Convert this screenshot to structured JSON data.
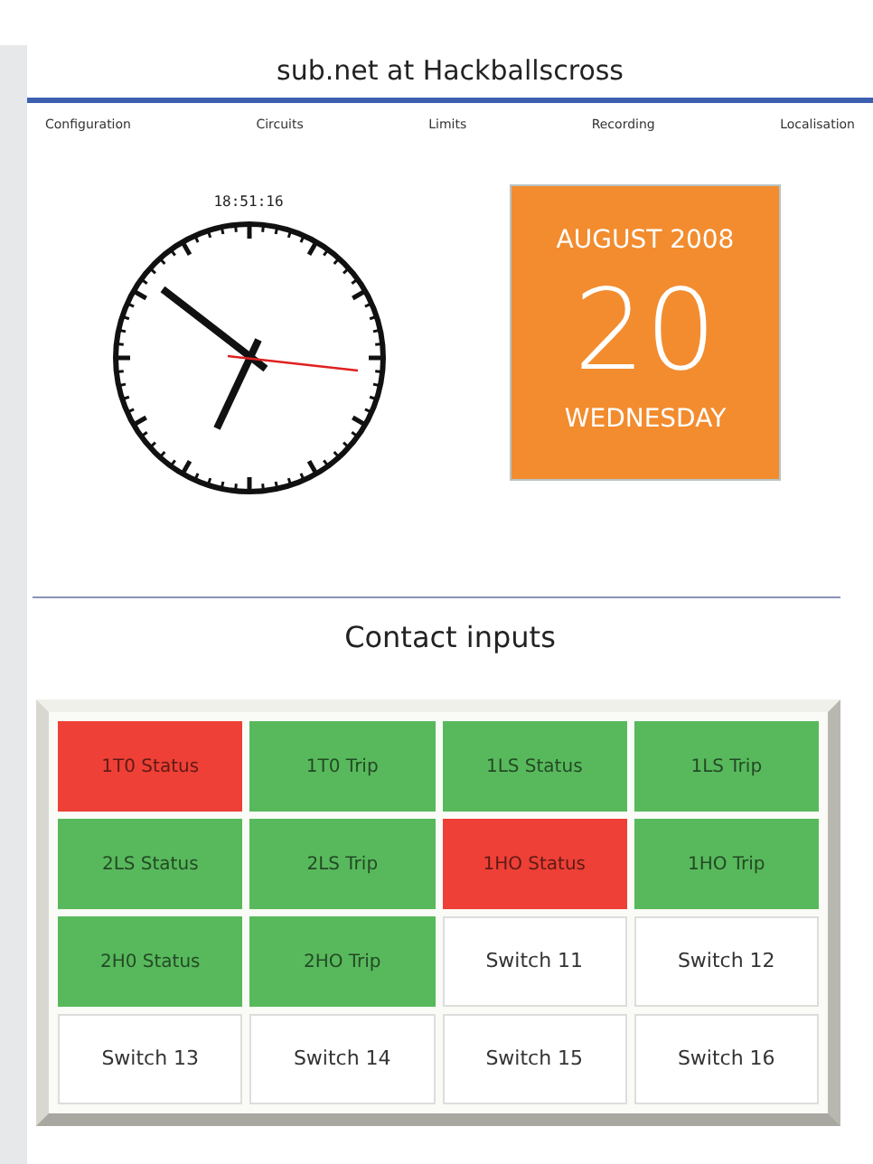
{
  "title": "sub.net at Hackballscross",
  "nav": [
    "Configuration",
    "Circuits",
    "Limits",
    "Recording",
    "Localisation"
  ],
  "clock": {
    "time": "18:51:16"
  },
  "calendar": {
    "month": "AUGUST 2008",
    "day": "20",
    "weekday": "WEDNESDAY"
  },
  "section_title": "Contact inputs",
  "inputs": [
    {
      "label": "1T0 Status",
      "color": "#ee4036"
    },
    {
      "label": "1T0 Trip",
      "color": "#58b95c"
    },
    {
      "label": "1LS Status",
      "color": "#58b95c"
    },
    {
      "label": "1LS Trip",
      "color": "#58b95c"
    },
    {
      "label": "2LS Status",
      "color": "#58b95c"
    },
    {
      "label": "2LS Trip",
      "color": "#58b95c"
    },
    {
      "label": "1HO Status",
      "color": "#ee4036"
    },
    {
      "label": "1HO Trip",
      "color": "#58b95c"
    },
    {
      "label": "2H0 Status",
      "color": "#58b95c"
    },
    {
      "label": "2HO Trip",
      "color": "#58b95c"
    },
    {
      "label": "Switch 11",
      "color": "#ffffff"
    },
    {
      "label": "Switch 12",
      "color": "#ffffff"
    },
    {
      "label": "Switch 13",
      "color": "#ffffff"
    },
    {
      "label": "Switch 14",
      "color": "#ffffff"
    },
    {
      "label": "Switch 15",
      "color": "#ffffff"
    },
    {
      "label": "Switch 16",
      "color": "#ffffff"
    }
  ]
}
